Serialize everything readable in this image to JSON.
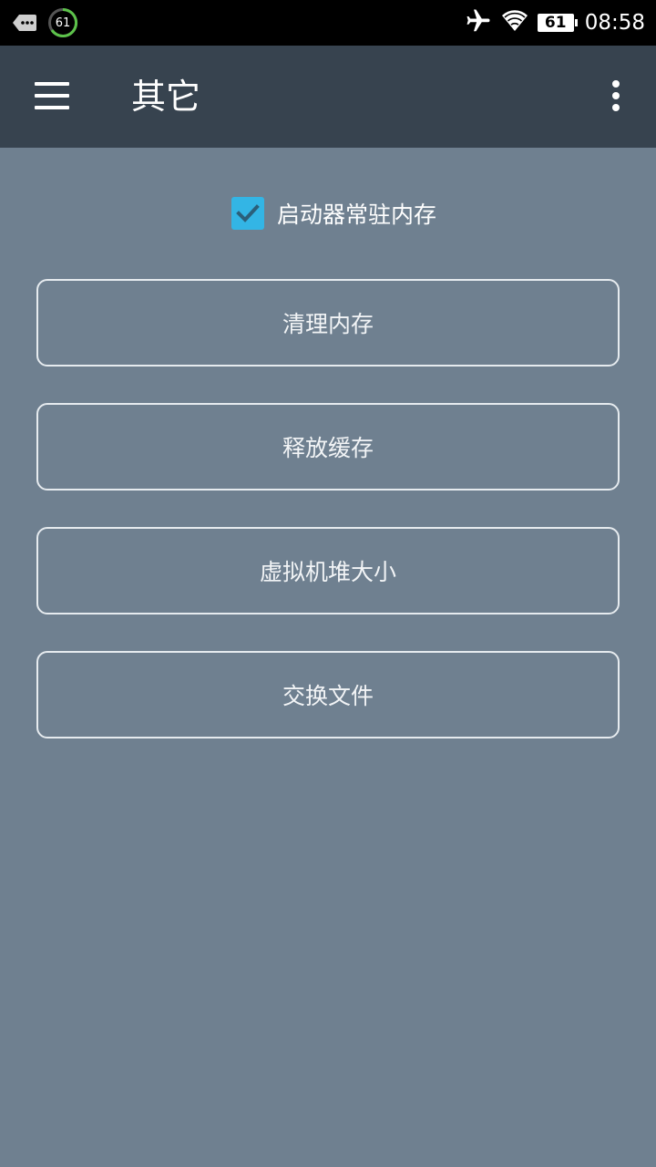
{
  "status_bar": {
    "notification_ring_value": "61",
    "battery_level": "61",
    "time": "08:58",
    "icons": [
      "message-icon",
      "airplane-mode-icon",
      "wifi-icon",
      "battery-icon"
    ]
  },
  "app_bar": {
    "title": "其它",
    "menu_icon": "hamburger-menu-icon",
    "overflow_icon": "overflow-menu-icon"
  },
  "main": {
    "resident_memory": {
      "label": "启动器常驻内存",
      "checked": true
    },
    "buttons": [
      {
        "label": "清理内存"
      },
      {
        "label": "释放缓存"
      },
      {
        "label": "虚拟机堆大小"
      },
      {
        "label": "交换文件"
      }
    ]
  },
  "colors": {
    "status_bar_bg": "#000000",
    "app_bar_bg": "#37434f",
    "content_bg": "#6f8090",
    "checkbox_accent": "#33b5e5"
  }
}
